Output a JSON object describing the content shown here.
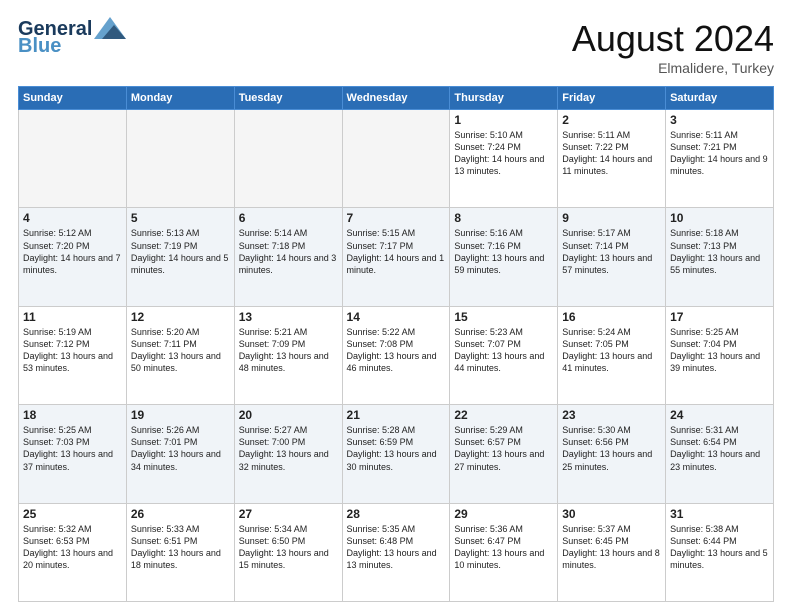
{
  "logo": {
    "line1": "General",
    "line2": "Blue"
  },
  "title": "August 2024",
  "location": "Elmalidere, Turkey",
  "days_of_week": [
    "Sunday",
    "Monday",
    "Tuesday",
    "Wednesday",
    "Thursday",
    "Friday",
    "Saturday"
  ],
  "weeks": [
    [
      {
        "day": "",
        "info": ""
      },
      {
        "day": "",
        "info": ""
      },
      {
        "day": "",
        "info": ""
      },
      {
        "day": "",
        "info": ""
      },
      {
        "day": "1",
        "info": "Sunrise: 5:10 AM\nSunset: 7:24 PM\nDaylight: 14 hours\nand 13 minutes."
      },
      {
        "day": "2",
        "info": "Sunrise: 5:11 AM\nSunset: 7:22 PM\nDaylight: 14 hours\nand 11 minutes."
      },
      {
        "day": "3",
        "info": "Sunrise: 5:11 AM\nSunset: 7:21 PM\nDaylight: 14 hours\nand 9 minutes."
      }
    ],
    [
      {
        "day": "4",
        "info": "Sunrise: 5:12 AM\nSunset: 7:20 PM\nDaylight: 14 hours\nand 7 minutes."
      },
      {
        "day": "5",
        "info": "Sunrise: 5:13 AM\nSunset: 7:19 PM\nDaylight: 14 hours\nand 5 minutes."
      },
      {
        "day": "6",
        "info": "Sunrise: 5:14 AM\nSunset: 7:18 PM\nDaylight: 14 hours\nand 3 minutes."
      },
      {
        "day": "7",
        "info": "Sunrise: 5:15 AM\nSunset: 7:17 PM\nDaylight: 14 hours\nand 1 minute."
      },
      {
        "day": "8",
        "info": "Sunrise: 5:16 AM\nSunset: 7:16 PM\nDaylight: 13 hours\nand 59 minutes."
      },
      {
        "day": "9",
        "info": "Sunrise: 5:17 AM\nSunset: 7:14 PM\nDaylight: 13 hours\nand 57 minutes."
      },
      {
        "day": "10",
        "info": "Sunrise: 5:18 AM\nSunset: 7:13 PM\nDaylight: 13 hours\nand 55 minutes."
      }
    ],
    [
      {
        "day": "11",
        "info": "Sunrise: 5:19 AM\nSunset: 7:12 PM\nDaylight: 13 hours\nand 53 minutes."
      },
      {
        "day": "12",
        "info": "Sunrise: 5:20 AM\nSunset: 7:11 PM\nDaylight: 13 hours\nand 50 minutes."
      },
      {
        "day": "13",
        "info": "Sunrise: 5:21 AM\nSunset: 7:09 PM\nDaylight: 13 hours\nand 48 minutes."
      },
      {
        "day": "14",
        "info": "Sunrise: 5:22 AM\nSunset: 7:08 PM\nDaylight: 13 hours\nand 46 minutes."
      },
      {
        "day": "15",
        "info": "Sunrise: 5:23 AM\nSunset: 7:07 PM\nDaylight: 13 hours\nand 44 minutes."
      },
      {
        "day": "16",
        "info": "Sunrise: 5:24 AM\nSunset: 7:05 PM\nDaylight: 13 hours\nand 41 minutes."
      },
      {
        "day": "17",
        "info": "Sunrise: 5:25 AM\nSunset: 7:04 PM\nDaylight: 13 hours\nand 39 minutes."
      }
    ],
    [
      {
        "day": "18",
        "info": "Sunrise: 5:25 AM\nSunset: 7:03 PM\nDaylight: 13 hours\nand 37 minutes."
      },
      {
        "day": "19",
        "info": "Sunrise: 5:26 AM\nSunset: 7:01 PM\nDaylight: 13 hours\nand 34 minutes."
      },
      {
        "day": "20",
        "info": "Sunrise: 5:27 AM\nSunset: 7:00 PM\nDaylight: 13 hours\nand 32 minutes."
      },
      {
        "day": "21",
        "info": "Sunrise: 5:28 AM\nSunset: 6:59 PM\nDaylight: 13 hours\nand 30 minutes."
      },
      {
        "day": "22",
        "info": "Sunrise: 5:29 AM\nSunset: 6:57 PM\nDaylight: 13 hours\nand 27 minutes."
      },
      {
        "day": "23",
        "info": "Sunrise: 5:30 AM\nSunset: 6:56 PM\nDaylight: 13 hours\nand 25 minutes."
      },
      {
        "day": "24",
        "info": "Sunrise: 5:31 AM\nSunset: 6:54 PM\nDaylight: 13 hours\nand 23 minutes."
      }
    ],
    [
      {
        "day": "25",
        "info": "Sunrise: 5:32 AM\nSunset: 6:53 PM\nDaylight: 13 hours\nand 20 minutes."
      },
      {
        "day": "26",
        "info": "Sunrise: 5:33 AM\nSunset: 6:51 PM\nDaylight: 13 hours\nand 18 minutes."
      },
      {
        "day": "27",
        "info": "Sunrise: 5:34 AM\nSunset: 6:50 PM\nDaylight: 13 hours\nand 15 minutes."
      },
      {
        "day": "28",
        "info": "Sunrise: 5:35 AM\nSunset: 6:48 PM\nDaylight: 13 hours\nand 13 minutes."
      },
      {
        "day": "29",
        "info": "Sunrise: 5:36 AM\nSunset: 6:47 PM\nDaylight: 13 hours\nand 10 minutes."
      },
      {
        "day": "30",
        "info": "Sunrise: 5:37 AM\nSunset: 6:45 PM\nDaylight: 13 hours\nand 8 minutes."
      },
      {
        "day": "31",
        "info": "Sunrise: 5:38 AM\nSunset: 6:44 PM\nDaylight: 13 hours\nand 5 minutes."
      }
    ]
  ]
}
